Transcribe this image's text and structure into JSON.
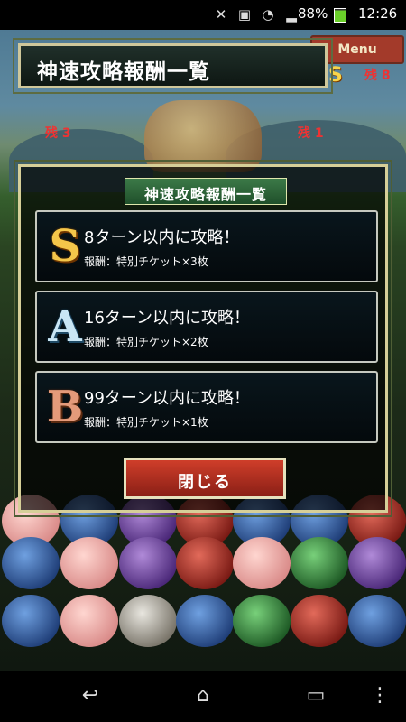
{
  "status_bar": {
    "battery_percent": "88%",
    "time": "12:26",
    "icons": [
      "no-sim-icon",
      "wifi-icon",
      "signal-icon"
    ]
  },
  "hud": {
    "menu_label": "Menu",
    "rank_letter": "S",
    "left_remaining": "残 3",
    "right_remaining": "残 1",
    "top_right_remaining": "残 8"
  },
  "title_banner": {
    "text": "神速攻略報酬一覧"
  },
  "modal": {
    "header": "神速攻略報酬一覧",
    "rewards": [
      {
        "rank": "S",
        "condition": "8ターン以内に攻略！",
        "prize": "報酬：特別チケット×3枚"
      },
      {
        "rank": "A",
        "condition": "16ターン以内に攻略！",
        "prize": "報酬：特別チケット×2枚"
      },
      {
        "rank": "B",
        "condition": "99ターン以内に攻略！",
        "prize": "報酬：特別チケット×1枚"
      }
    ],
    "close_label": "閉じる"
  },
  "nav": {
    "icons": [
      "back-icon",
      "home-icon",
      "recent-apps-icon",
      "overflow-menu-icon"
    ]
  }
}
